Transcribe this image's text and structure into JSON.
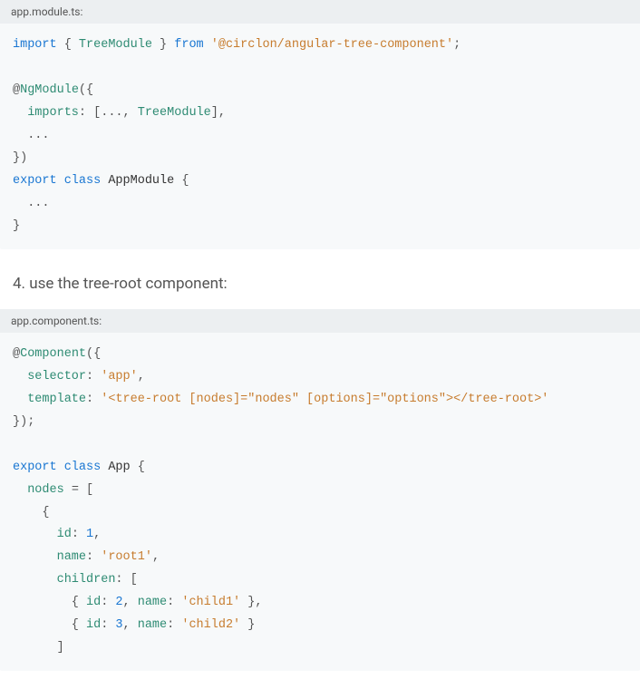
{
  "block1": {
    "header": "app.module.ts:",
    "line1_import": "import",
    "line1_braces_open": " { ",
    "line1_type": "TreeModule",
    "line1_braces_close": " } ",
    "line1_from": "from",
    "line1_str": " '@circlon/angular-tree-component'",
    "line1_semi": ";",
    "line2_at": "@",
    "line2_dec": "NgModule",
    "line2_paren": "({",
    "line3_prop": "  imports",
    "line3_mid": ": [..., ",
    "line3_type": "TreeModule",
    "line3_end": "],",
    "line4": "  ...",
    "line5": "})",
    "line6_export": "export",
    "line6_class": " class ",
    "line6_name": "AppModule",
    "line6_brace": " {",
    "line7": "  ...",
    "line8": "}"
  },
  "heading": "4. use the tree-root component:",
  "block2": {
    "header": "app.component.ts:",
    "l1_at": "@",
    "l1_dec": "Component",
    "l1_paren": "({",
    "l2_prop": "  selector",
    "l2_colon": ": ",
    "l2_str": "'app'",
    "l2_comma": ",",
    "l3_prop": "  template",
    "l3_colon": ": ",
    "l3_str": "'<tree-root [nodes]=\"nodes\" [options]=\"options\"></tree-root>'",
    "l4": "});",
    "l5_export": "export",
    "l5_class": " class ",
    "l5_name": "App",
    "l5_brace": " {",
    "l6_prop": "  nodes",
    "l6_eq": " = [",
    "l7": "    {",
    "l8_prop": "      id",
    "l8_colon": ": ",
    "l8_num": "1",
    "l8_comma": ",",
    "l9_prop": "      name",
    "l9_colon": ": ",
    "l9_str": "'root1'",
    "l9_comma": ",",
    "l10_prop": "      children",
    "l10_colon": ": [",
    "l11_open": "        { ",
    "l11_p1": "id",
    "l11_c1": ": ",
    "l11_n1": "2",
    "l11_cm1": ", ",
    "l11_p2": "name",
    "l11_c2": ": ",
    "l11_s2": "'child1'",
    "l11_close": " },",
    "l12_open": "        { ",
    "l12_p1": "id",
    "l12_c1": ": ",
    "l12_n1": "3",
    "l12_cm1": ", ",
    "l12_p2": "name",
    "l12_c2": ": ",
    "l12_s2": "'child2'",
    "l12_close": " }",
    "l13": "      ]"
  }
}
